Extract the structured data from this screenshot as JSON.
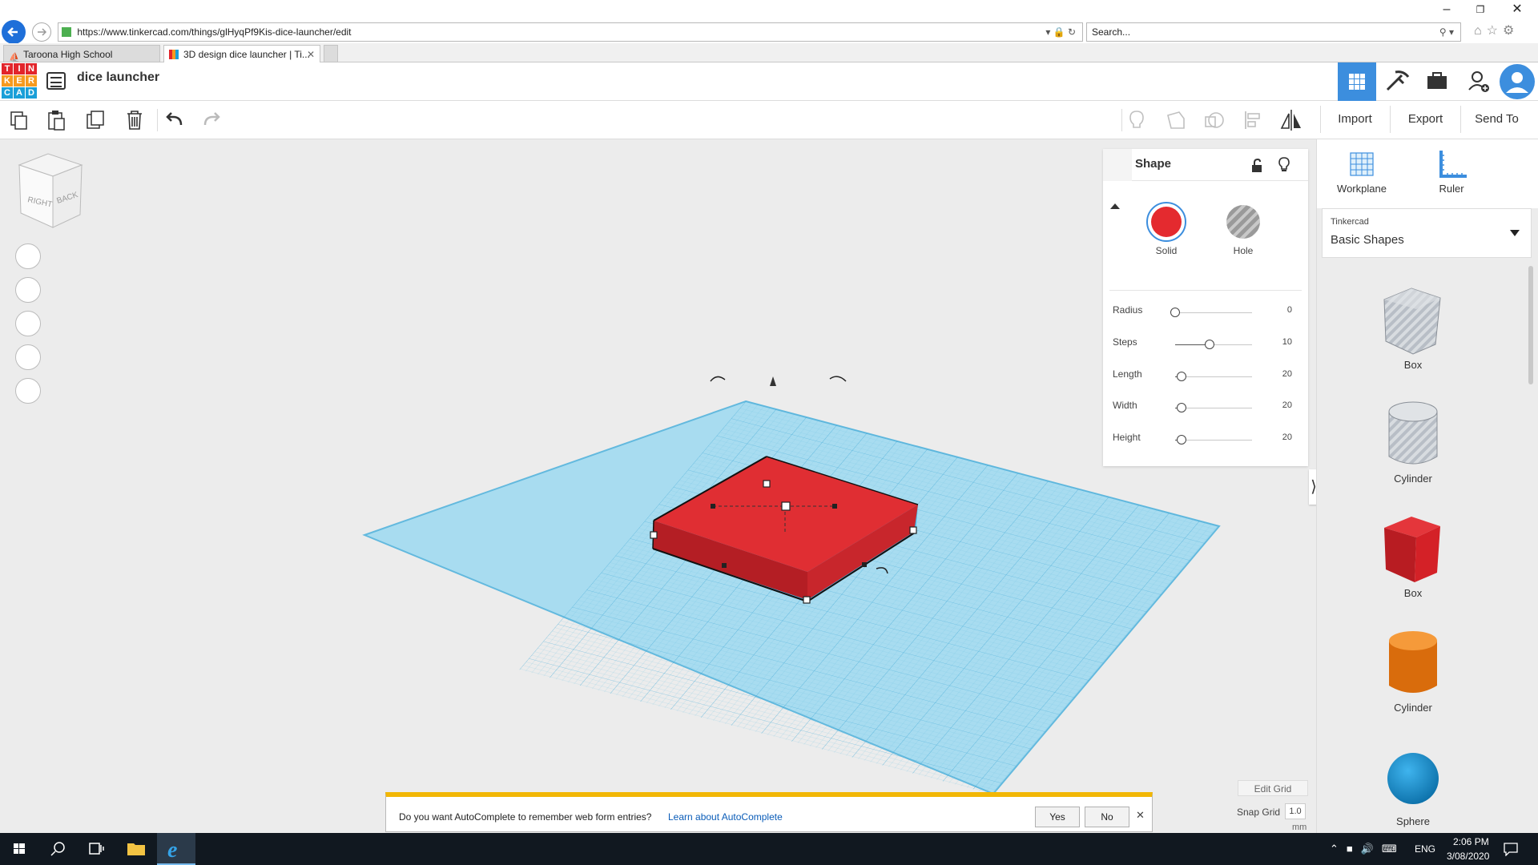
{
  "browser": {
    "url": "https://www.tinkercad.com/things/glHyqPf9Kis-dice-launcher/edit",
    "search_placeholder": "Search...",
    "tabs": [
      {
        "label": "Taroona High School"
      },
      {
        "label": "3D design dice launcher | Ti..."
      }
    ]
  },
  "app": {
    "logo_letters": [
      "T",
      "I",
      "N",
      "K",
      "E",
      "R",
      "C",
      "A",
      "D"
    ],
    "logo_colors": [
      "#e2252b",
      "#e2252b",
      "#e2252b",
      "#f69a1f",
      "#f69a1f",
      "#f69a1f",
      "#1a9fd8",
      "#1a9fd8",
      "#1a9fd8"
    ],
    "design_title": "dice launcher"
  },
  "toolbar": {
    "import_label": "Import",
    "export_label": "Export",
    "send_to_label": "Send To"
  },
  "view_cube": {
    "right_label": "RIGHT",
    "back_label": "BACK"
  },
  "inspector": {
    "title": "Shape",
    "solid_label": "Solid",
    "hole_label": "Hole",
    "solid_color": "#e42a2f",
    "params": [
      {
        "label": "Radius",
        "value": "0",
        "level": 0.0
      },
      {
        "label": "Steps",
        "value": "10",
        "level": 0.45
      },
      {
        "label": "Length",
        "value": "20",
        "level": 0.08
      },
      {
        "label": "Width",
        "value": "20",
        "level": 0.08
      },
      {
        "label": "Height",
        "value": "20",
        "level": 0.08
      }
    ]
  },
  "shapes_panel": {
    "workplane_label": "Workplane",
    "ruler_label": "Ruler",
    "library_source": "Tinkercad",
    "library_name": "Basic Shapes",
    "shapes": [
      {
        "label": "Box",
        "icon": "box-hole-icon",
        "color": "#9aa0a8"
      },
      {
        "label": "Cylinder",
        "icon": "cylinder-hole-icon",
        "color": "#9aa0a8"
      },
      {
        "label": "Box",
        "icon": "box-solid-icon",
        "color": "#d42127"
      },
      {
        "label": "Cylinder",
        "icon": "cylinder-solid-icon",
        "color": "#ea7a11"
      },
      {
        "label": "Sphere",
        "icon": "sphere-icon",
        "color": "#1a8fd0"
      }
    ]
  },
  "grid_controls": {
    "edit_grid_label": "Edit Grid",
    "snap_grid_label": "Snap Grid",
    "snap_value": "1.0",
    "snap_unit": "mm"
  },
  "autocomplete": {
    "message": "Do you want AutoComplete to remember web form entries?",
    "link": "Learn about AutoComplete",
    "yes": "Yes",
    "no": "No"
  },
  "taskbar": {
    "language": "ENG",
    "time": "2:06 PM",
    "date": "3/08/2020"
  },
  "colors": {
    "accent_blue": "#3c8ede",
    "workplane": "#a8dcf0",
    "shape_red": "#e42a2f"
  }
}
